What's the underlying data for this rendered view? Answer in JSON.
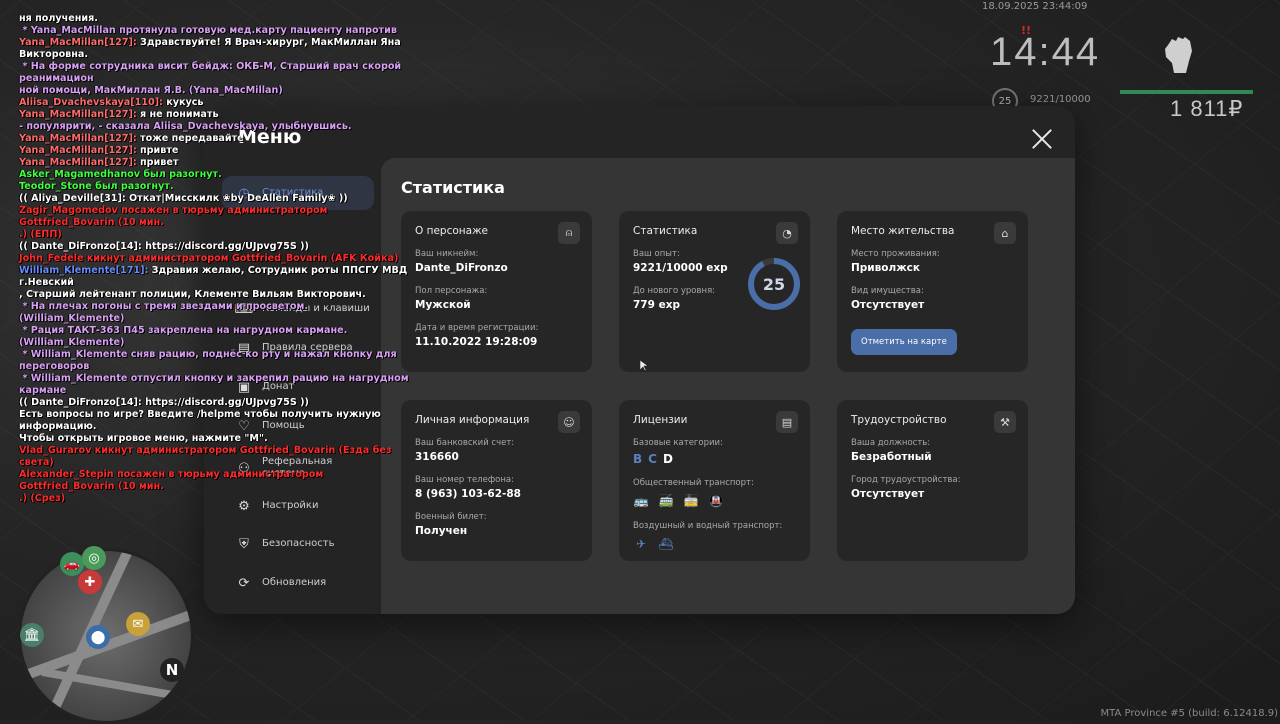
{
  "hud": {
    "datetime": "18.09.2025 23:44:09",
    "clock": "14:44",
    "warning": "!!",
    "level": "25",
    "exp": "9221/10000",
    "money": "1 811₽",
    "version": "MTA Province #5 (build: 6.12418.9)"
  },
  "chat": [
    {
      "t": "ня получения.",
      "c": "white"
    },
    {
      "t": " * Yana_MacMillan протянула готовую мед.карту пациенту напротив",
      "c": "rp"
    },
    {
      "t": "Yana_MacMillan[127]: Здравствуйте! Я Врач-хирург, МакМиллан Яна Викторовна.",
      "c": "mix",
      "n": "Yana_MacMillan[127]:",
      "r": " Здравствуйте! Я Врач-хирург, МакМиллан Яна Викторовна."
    },
    {
      "t": " * На форме сотрудника висит бейдж: ОКБ-М, Старший врач скорой реанимацион",
      "c": "rp"
    },
    {
      "t": "ной помощи, МакМиллан Я.В. (Yana_MacMillan)",
      "c": "rp"
    },
    {
      "t": "Aliisa_Dvachevskaya[110]: кукусь",
      "c": "mix",
      "n": "Aliisa_Dvachevskaya[110]:",
      "r": " кукусь"
    },
    {
      "t": "Yana_MacMillan[127]: я не понимать",
      "c": "mix",
      "n": "Yana_MacMillan[127]:",
      "r": " я не понимать"
    },
    {
      "t": "- популярити, - сказала Aliisa_Dvachevskaya, улыбнувшись.",
      "c": "rp"
    },
    {
      "t": "Yana_MacMillan[127]: тоже передавайте",
      "c": "mix",
      "n": "Yana_MacMillan[127]:",
      "r": " тоже передавайте"
    },
    {
      "t": "Yana_MacMillan[127]: привте",
      "c": "mix",
      "n": "Yana_MacMillan[127]:",
      "r": " привте"
    },
    {
      "t": "Yana_MacMillan[127]: привет",
      "c": "mix",
      "n": "Yana_MacMillan[127]:",
      "r": " привет"
    },
    {
      "t": "Asker_Magamedhanov был разогнут.",
      "c": "green"
    },
    {
      "t": "Teodor_Stone был разогнут.",
      "c": "green"
    },
    {
      "t": "(( Aliya_Deville[31]: Откат|Мисскилк ❀by DeAllen Family❀ ))",
      "c": "white"
    },
    {
      "t": "Zagir_Magomedov посажен в тюрьму администратором Gottfried_Bovarin (10 мин.",
      "c": "red"
    },
    {
      "t": ".) (ЕПП)",
      "c": "red"
    },
    {
      "t": "(( Dante_DiFronzo[14]: https://discord.gg/UJpvg75S ))",
      "c": "white"
    },
    {
      "t": "John_Fedele кикнут администратором Gottfried_Bovarin (АFK Койка)",
      "c": "red"
    },
    {
      "t": "William_Klemente[171]: Здравия желаю, Сотрудник роты ППСГУ МВД г.Невский",
      "c": "mixb",
      "n": "William_Klemente[171]:",
      "r": " Здравия желаю, Сотрудник роты ППСГУ МВД г.Невский"
    },
    {
      "t": ", Старший лейтенант полиции, Клементе Вильям Викторович.",
      "c": "white"
    },
    {
      "t": " * На плечах погоны с тремя звездами и просветом. (William_Klemente)",
      "c": "rp"
    },
    {
      "t": " * Рация ТАКТ-363 П45 закреплена на нагрудном кармане. (William_Klemente)",
      "c": "rp"
    },
    {
      "t": " * William_Klemente сняв рацию, поднёс ко рту и нажал кнопку для переговоров",
      "c": "rp"
    },
    {
      "t": " * William_Klemente отпустил кнопку и закрепил рацию на нагрудном кармане",
      "c": "rp"
    },
    {
      "t": "(( Dante_DiFronzo[14]: https://discord.gg/UJpvg75S ))",
      "c": "white"
    },
    {
      "t": "Есть вопросы по игре? Введите /helpme чтобы получить нужную информацию.",
      "c": "white"
    },
    {
      "t": "Чтобы открыть игровое меню, нажмите \"M\".",
      "c": "white"
    },
    {
      "t": "Vlad_Gurarov кикнут администратором Gottfried_Bovarin (Езда без света)",
      "c": "red"
    },
    {
      "t": "Alexander_Stepin посажен в тюрьму администратором Gottfried_Bovarin (10 мин.",
      "c": "red"
    },
    {
      "t": ".) (Срез)",
      "c": "red"
    }
  ],
  "menu": {
    "title": "Меню",
    "nav": [
      {
        "label": "Статистика",
        "icon": "clock-icon",
        "glyph": "◷",
        "name": "nav-statistics",
        "active": true
      },
      {
        "label": "",
        "icon": "list-icon",
        "glyph": "",
        "name": "nav-hidden-1",
        "active": false
      },
      {
        "label": "",
        "icon": "list-icon",
        "glyph": "",
        "name": "nav-hidden-2",
        "active": false
      },
      {
        "label": "Команды и клавиши",
        "icon": "keyboard-icon",
        "glyph": "⌨",
        "name": "nav-commands",
        "active": false
      },
      {
        "label": "Правила сервера",
        "icon": "book-icon",
        "glyph": "▤",
        "name": "nav-rules",
        "active": false
      },
      {
        "label": "Донат",
        "icon": "wallet-icon",
        "glyph": "▣",
        "name": "nav-donate",
        "active": false
      },
      {
        "label": "Помощь",
        "icon": "heart-hands-icon",
        "glyph": "♡",
        "name": "nav-help",
        "active": false
      },
      {
        "label": "Реферальная система",
        "icon": "network-icon",
        "glyph": "⚇",
        "name": "nav-referral",
        "active": false
      },
      {
        "label": "Настройки",
        "icon": "gear-icon",
        "glyph": "⚙",
        "name": "nav-settings",
        "active": false
      },
      {
        "label": "Безопасность",
        "icon": "shield-icon",
        "glyph": "⛨",
        "name": "nav-security",
        "active": false
      },
      {
        "label": "Обновления",
        "icon": "refresh-check-icon",
        "glyph": "⟳",
        "name": "nav-updates",
        "active": false
      }
    ],
    "content_title": "Статистика",
    "cards": {
      "about": {
        "title": "О персонаже",
        "l1": "Ваш никнейм:",
        "v1": "Dante_DiFronzo",
        "l2": "Пол персонажа:",
        "v2": "Мужской",
        "l3": "Дата и время регистрации:",
        "v3": "11.10.2022 19:28:09"
      },
      "stats": {
        "title": "Статистика",
        "l1": "Ваш опыт:",
        "v1": "9221/10000 exp",
        "l2": "До нового уровня:",
        "v2": "779 exp",
        "level": "25",
        "progress": 0.9221
      },
      "residence": {
        "title": "Место жительства",
        "l1": "Место проживания:",
        "v1": "Приволжск",
        "l2": "Вид имущества:",
        "v2": "Отсутствует",
        "button": "Отметить на карте"
      },
      "personal": {
        "title": "Личная информация",
        "l1": "Ваш банковский счет:",
        "v1": "316660",
        "l2": "Ваш номер телефона:",
        "v2": "8 (963) 103-62-88",
        "l3": "Военный билет:",
        "v3": "Получен"
      },
      "licenses": {
        "title": "Лицензии",
        "l1": "Базовые категории:",
        "cat_b": "B",
        "cat_c": "C",
        "cat_d": "D",
        "l2": "Общественный транспорт:",
        "l3": "Воздушный и водный транспорт:"
      },
      "job": {
        "title": "Трудоустройство",
        "l1": "Ваша должность:",
        "v1": "Безработный",
        "l2": "Город трудоустройства:",
        "v2": "Отсутствует"
      }
    }
  },
  "colors": {
    "accent": "#4a6ea8",
    "active_nav_bg": "#2f3543",
    "panel": "#242424",
    "content": "#353535",
    "card": "#262626"
  }
}
